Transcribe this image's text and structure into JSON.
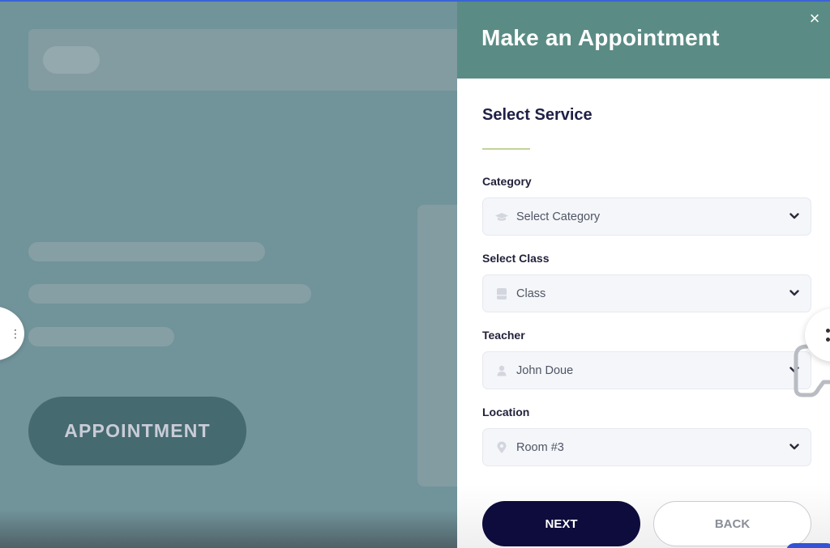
{
  "background_page": {
    "appointment_button_label": "APPOINTMENT"
  },
  "modal": {
    "title": "Make an Appointment",
    "close_icon": "×",
    "section_title": "Select Service",
    "fields": [
      {
        "label": "Category",
        "icon": "graduation-cap-icon",
        "value": "Select Category",
        "is_placeholder": true
      },
      {
        "label": "Select Class",
        "icon": "book-icon",
        "value": "Class",
        "is_placeholder": true
      },
      {
        "label": "Teacher",
        "icon": "user-icon",
        "value": "John Doue",
        "is_placeholder": false
      },
      {
        "label": "Location",
        "icon": "map-pin-icon",
        "value": "Room #3",
        "is_placeholder": false
      }
    ],
    "next_label": "NEXT",
    "back_label": "BACK"
  },
  "colors": {
    "header": "#5a8c85",
    "primary_button": "#0d0c3c",
    "accent_underline": "#c3d29a",
    "overlay": "#71939a"
  }
}
